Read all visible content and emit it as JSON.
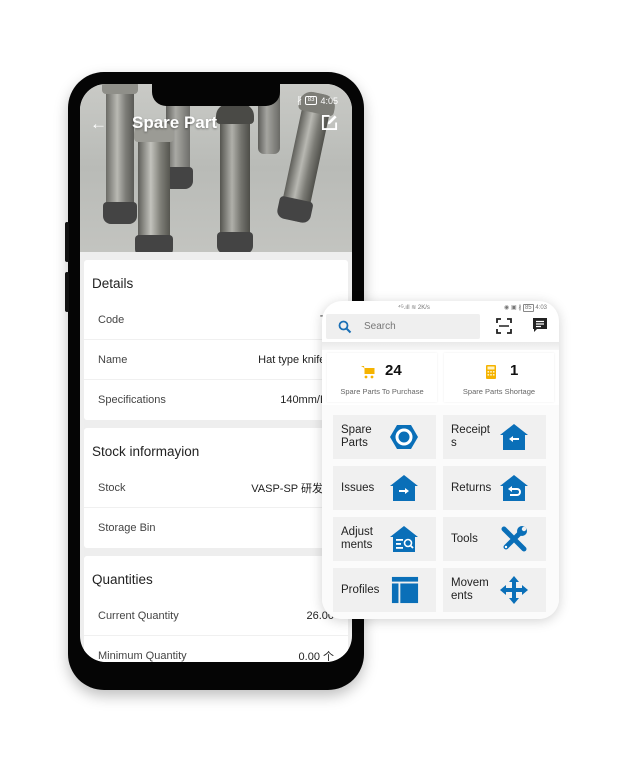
{
  "main_phone": {
    "status_bar": {
      "time": "4:05",
      "battery": "83"
    },
    "appbar": {
      "title": "Spare Part",
      "back_icon": "arrow-left-icon",
      "edit_icon": "edit-icon"
    },
    "sections": [
      {
        "title": "Details",
        "rows": [
          {
            "label": "Code",
            "value": "TE"
          },
          {
            "label": "Name",
            "value": "Hat type knife c"
          },
          {
            "label": "Specifications",
            "value": "140mm/BT"
          }
        ]
      },
      {
        "title": "Stock informayion",
        "rows": [
          {
            "label": "Stock",
            "value": "VASP-SP 研发中"
          },
          {
            "label": "Storage Bin",
            "value": ""
          }
        ]
      },
      {
        "title": "Quantities",
        "rows": [
          {
            "label": "Current Quantity",
            "value": "26.00"
          },
          {
            "label": "Minimum Quantity",
            "value": "0.00 个"
          }
        ]
      }
    ]
  },
  "panel": {
    "status_bar": {
      "network": "⁴ᴳ.ıll ≋ 2K/s",
      "time": "4:03",
      "battery": "85"
    },
    "search": {
      "placeholder": "Search"
    },
    "stats": [
      {
        "value": "24",
        "label": "Spare Parts To Purchase",
        "icon": "cart-icon",
        "color": "#f5b301"
      },
      {
        "value": "1",
        "label": "Spare Parts Shortage",
        "icon": "calculator-icon",
        "color": "#f5b301"
      }
    ],
    "tiles": [
      {
        "label": "Spare Parts",
        "icon": "hex-nut-icon"
      },
      {
        "label": "Receipts",
        "icon": "house-arrow-left-icon"
      },
      {
        "label": "Issues",
        "icon": "house-arrow-right-icon"
      },
      {
        "label": "Returns",
        "icon": "house-return-icon"
      },
      {
        "label": "Adjustments",
        "icon": "house-search-icon"
      },
      {
        "label": "Tools",
        "icon": "tools-icon"
      },
      {
        "label": "Profiles",
        "icon": "layout-icon"
      },
      {
        "label": "Movements",
        "icon": "move-arrows-icon"
      }
    ],
    "tile_labels_wrapped": [
      "Spare\nParts",
      "Receipt\ns",
      "Issues",
      "Returns",
      "Adjust\nments",
      "Tools",
      "Profiles",
      "Movem\nents"
    ],
    "accent_color": "#0a6fb8"
  }
}
